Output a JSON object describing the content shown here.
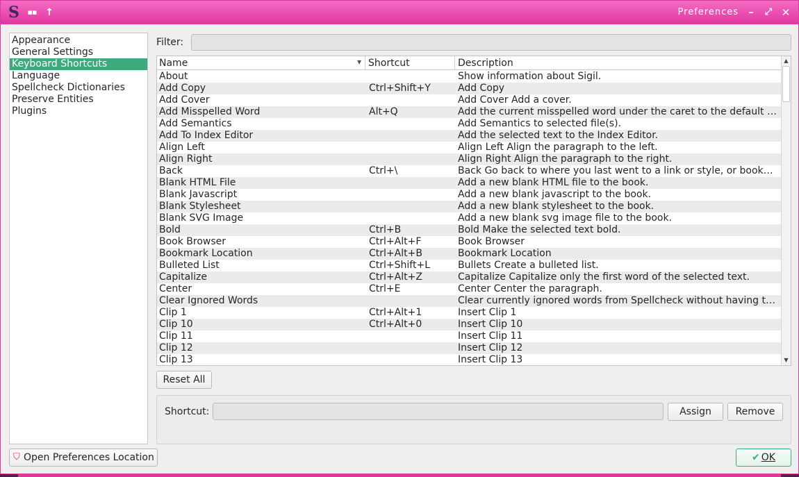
{
  "window": {
    "title": "Preferences",
    "app_logo": "S",
    "icons": [
      "sigil-logo-icon",
      "grid-icon",
      "arrow-up-icon",
      "minimize-icon",
      "maximize-icon",
      "close-icon"
    ]
  },
  "sidebar": {
    "items": [
      {
        "label": "Appearance"
      },
      {
        "label": "General Settings"
      },
      {
        "label": "Keyboard Shortcuts",
        "selected": true
      },
      {
        "label": "Language"
      },
      {
        "label": "Spellcheck Dictionaries"
      },
      {
        "label": "Preserve Entities"
      },
      {
        "label": "Plugins"
      }
    ]
  },
  "filter": {
    "label": "Filter:",
    "value": ""
  },
  "table": {
    "columns": {
      "name": "Name",
      "shortcut": "Shortcut",
      "description": "Description"
    },
    "rows": [
      {
        "name": "About",
        "shortcut": "",
        "description": "Show information about Sigil."
      },
      {
        "name": "Add Copy",
        "shortcut": "Ctrl+Shift+Y",
        "description": "Add Copy"
      },
      {
        "name": "Add Cover",
        "shortcut": "",
        "description": "Add Cover Add a cover."
      },
      {
        "name": "Add Misspelled Word",
        "shortcut": "Alt+Q",
        "description": "Add the current misspelled word under the caret to the default us…"
      },
      {
        "name": "Add Semantics",
        "shortcut": "",
        "description": "Add Semantics to selected file(s)."
      },
      {
        "name": "Add To Index Editor",
        "shortcut": "",
        "description": "Add the selected text to the Index Editor."
      },
      {
        "name": "Align Left",
        "shortcut": "",
        "description": "Align Left Align the paragraph to the left."
      },
      {
        "name": "Align Right",
        "shortcut": "",
        "description": "Align Right Align the paragraph to the right."
      },
      {
        "name": "Back",
        "shortcut": "Ctrl+\\",
        "description": "Back Go back to where you last went to a link or style, or bookmar…"
      },
      {
        "name": "Blank HTML File",
        "shortcut": "",
        "description": "Add a new blank HTML file to the book."
      },
      {
        "name": "Blank Javascript",
        "shortcut": "",
        "description": "Add a new blank javascript to the book."
      },
      {
        "name": "Blank Stylesheet",
        "shortcut": "",
        "description": "Add a new blank stylesheet to the book."
      },
      {
        "name": "Blank SVG Image",
        "shortcut": "",
        "description": "Add a new blank svg image file to the book."
      },
      {
        "name": "Bold",
        "shortcut": "Ctrl+B",
        "description": "Bold Make the selected text bold."
      },
      {
        "name": "Book Browser",
        "shortcut": "Ctrl+Alt+F",
        "description": "Book Browser"
      },
      {
        "name": "Bookmark Location",
        "shortcut": "Ctrl+Alt+B",
        "description": "Bookmark Location"
      },
      {
        "name": "Bulleted List",
        "shortcut": "Ctrl+Shift+L",
        "description": "Bullets Create a bulleted list."
      },
      {
        "name": "Capitalize",
        "shortcut": "Ctrl+Alt+Z",
        "description": "Capitalize Capitalize only the first word of the selected text."
      },
      {
        "name": "Center",
        "shortcut": "Ctrl+E",
        "description": "Center Center the paragraph."
      },
      {
        "name": "Clear Ignored Words",
        "shortcut": "",
        "description": "Clear currently ignored words from Spellcheck without having to r…"
      },
      {
        "name": "Clip 1",
        "shortcut": "Ctrl+Alt+1",
        "description": "Insert Clip 1"
      },
      {
        "name": "Clip 10",
        "shortcut": "Ctrl+Alt+0",
        "description": "Insert Clip 10"
      },
      {
        "name": "Clip 11",
        "shortcut": "",
        "description": "Insert Clip 11"
      },
      {
        "name": "Clip 12",
        "shortcut": "",
        "description": "Insert Clip 12"
      },
      {
        "name": "Clip 13",
        "shortcut": "",
        "description": "Insert Clip 13"
      }
    ]
  },
  "buttons": {
    "reset_all": "Reset All",
    "assign": "Assign",
    "remove": "Remove",
    "open_prefs": "Open Preferences Location",
    "ok": "OK"
  },
  "shortcut_editor": {
    "label": "Shortcut:",
    "value": ""
  },
  "colors": {
    "titlebar": "#e2359f",
    "selection": "#3daa7e",
    "row_alt": "#ebebeb"
  }
}
